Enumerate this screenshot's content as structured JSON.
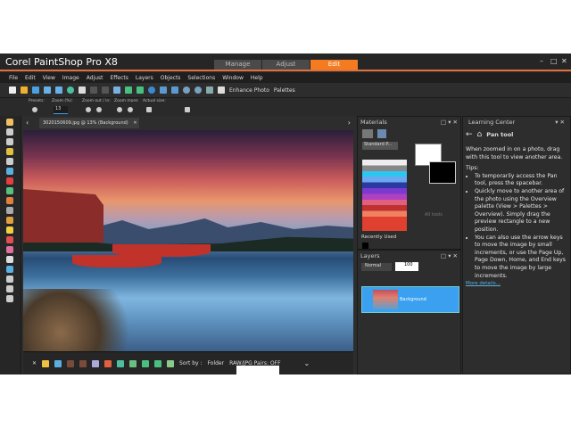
{
  "app": {
    "title": "Corel PaintShop Pro X8",
    "tabs": [
      "Manage",
      "Adjust",
      "Edit"
    ],
    "active_tab": "Edit"
  },
  "menu": [
    "File",
    "Edit",
    "View",
    "Image",
    "Adjust",
    "Effects",
    "Layers",
    "Objects",
    "Selections",
    "Window",
    "Help"
  ],
  "toolbar": {
    "enhance_photo": "Enhance Photo",
    "palettes": "Palettes"
  },
  "options": {
    "presets": "Presets:",
    "zoom_pct": "Zoom (%):",
    "zoom_value": "13",
    "zoom_out_in": "Zoom out / in:",
    "zoom_more": "Zoom more:",
    "actual_size": "Actual size:"
  },
  "document": {
    "tab_title": "30201506​09.jpg @  13% (Background)"
  },
  "organizer": {
    "sort_by": "Sort by :",
    "sort_value": "Folder",
    "raw_jpg": "RAW/JPG Pairs: OFF"
  },
  "materials": {
    "title": "Materials",
    "palette_select": "Standard P...",
    "recently_used": "Recently Used",
    "all_tools": "All tools"
  },
  "layers": {
    "title": "Layers",
    "blend_mode": "Normal",
    "opacity": "100",
    "layer_name": "Background"
  },
  "learning_center": {
    "title": "Learning Center",
    "tool": "Pan tool",
    "intro": "When zoomed in on a photo, drag with this tool to view another area.",
    "tips_label": "Tips:",
    "tips": [
      "To temporarily access the Pan tool, press the spacebar.",
      "Quickly move to another area of the photo using the Overview palette (View > Palettes > Overview). Simply drag the preview rectangle to a new position.",
      "You can also use the arrow keys to move the image by small increments, or use the Page Up, Page Down, Home, and End keys to move the image by large increments."
    ],
    "more": "More details..."
  },
  "colors": {
    "accent": "#f47b20",
    "selection": "#3aa0ef"
  }
}
